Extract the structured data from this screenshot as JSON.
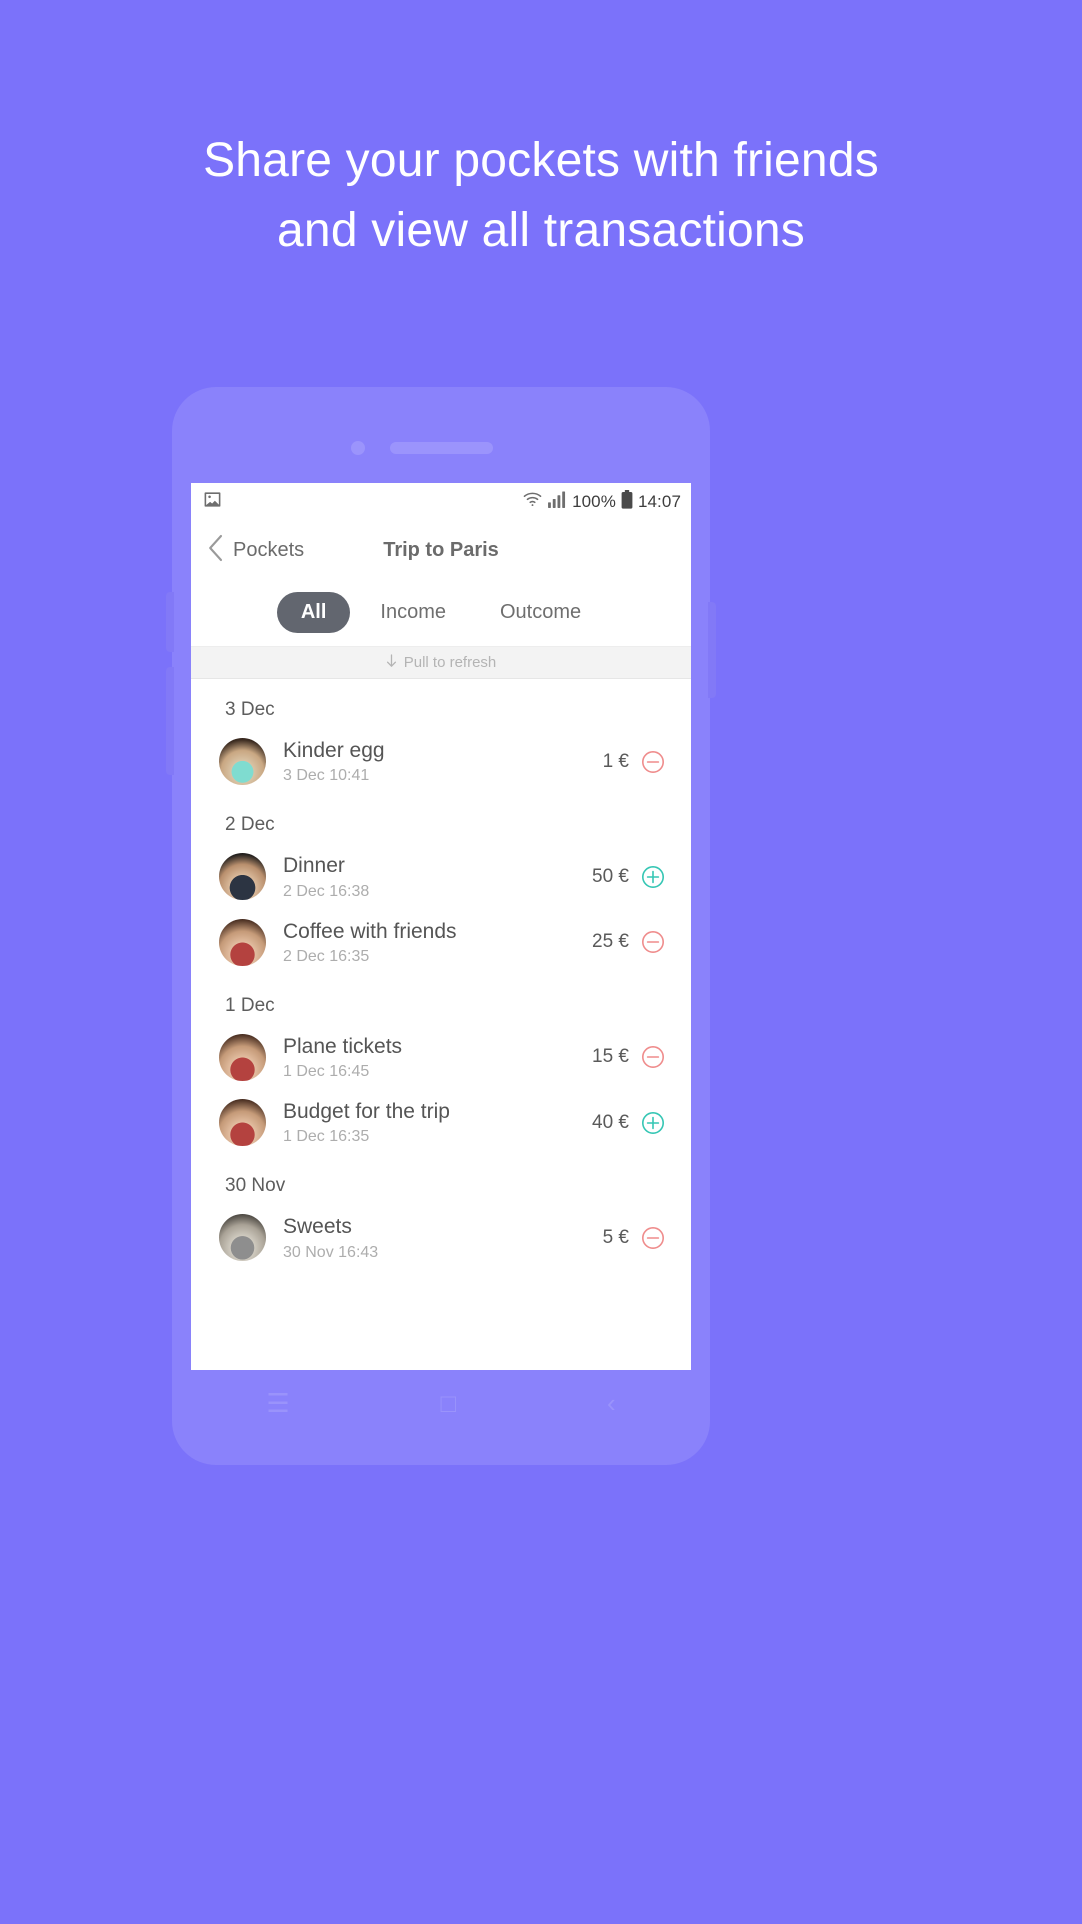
{
  "promo": {
    "headline_line1": "Share your pockets with friends",
    "headline_line2": "and view all transactions",
    "background_color": "#7b72fa"
  },
  "statusbar": {
    "screenshot_icon": "image-icon",
    "wifi_icon": "wifi-icon",
    "signal_icon": "cellular-signal-icon",
    "battery_percent": "100%",
    "battery_icon": "battery-full-icon",
    "time": "14:07"
  },
  "navbar": {
    "back_icon": "chevron-left-icon",
    "back_label": "Pockets",
    "title": "Trip to Paris"
  },
  "tabs": [
    {
      "label": "All",
      "active": true
    },
    {
      "label": "Income",
      "active": false
    },
    {
      "label": "Outcome",
      "active": false
    }
  ],
  "refresh": {
    "arrow_icon": "arrow-down-icon",
    "label": "Pull to refresh"
  },
  "colors": {
    "income": "#35c6b4",
    "outcome": "#ef8c8c",
    "active_tab_bg": "#62666f"
  },
  "groups": [
    {
      "date": "3 Dec",
      "transactions": [
        {
          "title": "Kinder egg",
          "time": "3 Dec 10:41",
          "amount": "1 €",
          "type": "outcome",
          "type_icon": "minus-circle-icon",
          "avatar": "avatar-1"
        }
      ]
    },
    {
      "date": "2 Dec",
      "transactions": [
        {
          "title": "Dinner",
          "time": "2 Dec 16:38",
          "amount": "50 €",
          "type": "income",
          "type_icon": "plus-circle-icon",
          "avatar": "avatar-2"
        },
        {
          "title": "Coffee with friends",
          "time": "2 Dec 16:35",
          "amount": "25 €",
          "type": "outcome",
          "type_icon": "minus-circle-icon",
          "avatar": "avatar-3"
        }
      ]
    },
    {
      "date": "1 Dec",
      "transactions": [
        {
          "title": "Plane tickets",
          "time": "1 Dec 16:45",
          "amount": "15 €",
          "type": "outcome",
          "type_icon": "minus-circle-icon",
          "avatar": "avatar-3"
        },
        {
          "title": "Budget for the trip",
          "time": "1 Dec 16:35",
          "amount": "40 €",
          "type": "income",
          "type_icon": "plus-circle-icon",
          "avatar": "avatar-3"
        }
      ]
    },
    {
      "date": "30 Nov",
      "transactions": [
        {
          "title": "Sweets",
          "time": "30 Nov 16:43",
          "amount": "5 €",
          "type": "outcome",
          "type_icon": "minus-circle-icon",
          "avatar": "avatar-4"
        }
      ]
    }
  ],
  "softnav": {
    "menu_icon": "menu-icon",
    "home_icon": "home-square-icon",
    "back_icon": "back-chevron-icon"
  }
}
